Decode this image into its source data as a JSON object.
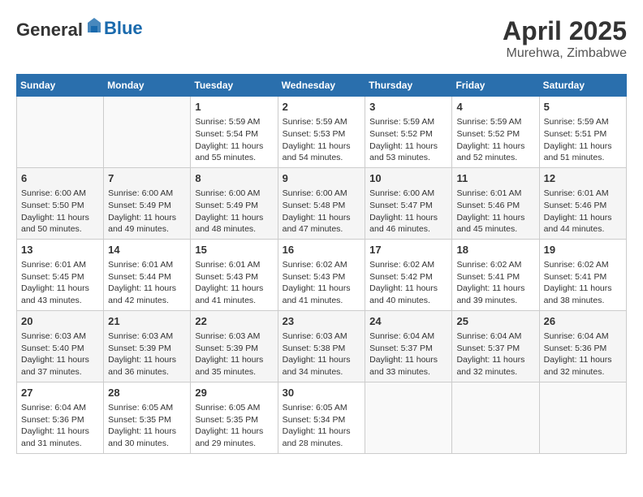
{
  "header": {
    "logo_general": "General",
    "logo_blue": "Blue",
    "month": "April 2025",
    "location": "Murehwa, Zimbabwe"
  },
  "weekdays": [
    "Sunday",
    "Monday",
    "Tuesday",
    "Wednesday",
    "Thursday",
    "Friday",
    "Saturday"
  ],
  "weeks": [
    [
      {
        "day": "",
        "info": ""
      },
      {
        "day": "",
        "info": ""
      },
      {
        "day": "1",
        "info": "Sunrise: 5:59 AM\nSunset: 5:54 PM\nDaylight: 11 hours and 55 minutes."
      },
      {
        "day": "2",
        "info": "Sunrise: 5:59 AM\nSunset: 5:53 PM\nDaylight: 11 hours and 54 minutes."
      },
      {
        "day": "3",
        "info": "Sunrise: 5:59 AM\nSunset: 5:52 PM\nDaylight: 11 hours and 53 minutes."
      },
      {
        "day": "4",
        "info": "Sunrise: 5:59 AM\nSunset: 5:52 PM\nDaylight: 11 hours and 52 minutes."
      },
      {
        "day": "5",
        "info": "Sunrise: 5:59 AM\nSunset: 5:51 PM\nDaylight: 11 hours and 51 minutes."
      }
    ],
    [
      {
        "day": "6",
        "info": "Sunrise: 6:00 AM\nSunset: 5:50 PM\nDaylight: 11 hours and 50 minutes."
      },
      {
        "day": "7",
        "info": "Sunrise: 6:00 AM\nSunset: 5:49 PM\nDaylight: 11 hours and 49 minutes."
      },
      {
        "day": "8",
        "info": "Sunrise: 6:00 AM\nSunset: 5:49 PM\nDaylight: 11 hours and 48 minutes."
      },
      {
        "day": "9",
        "info": "Sunrise: 6:00 AM\nSunset: 5:48 PM\nDaylight: 11 hours and 47 minutes."
      },
      {
        "day": "10",
        "info": "Sunrise: 6:00 AM\nSunset: 5:47 PM\nDaylight: 11 hours and 46 minutes."
      },
      {
        "day": "11",
        "info": "Sunrise: 6:01 AM\nSunset: 5:46 PM\nDaylight: 11 hours and 45 minutes."
      },
      {
        "day": "12",
        "info": "Sunrise: 6:01 AM\nSunset: 5:46 PM\nDaylight: 11 hours and 44 minutes."
      }
    ],
    [
      {
        "day": "13",
        "info": "Sunrise: 6:01 AM\nSunset: 5:45 PM\nDaylight: 11 hours and 43 minutes."
      },
      {
        "day": "14",
        "info": "Sunrise: 6:01 AM\nSunset: 5:44 PM\nDaylight: 11 hours and 42 minutes."
      },
      {
        "day": "15",
        "info": "Sunrise: 6:01 AM\nSunset: 5:43 PM\nDaylight: 11 hours and 41 minutes."
      },
      {
        "day": "16",
        "info": "Sunrise: 6:02 AM\nSunset: 5:43 PM\nDaylight: 11 hours and 41 minutes."
      },
      {
        "day": "17",
        "info": "Sunrise: 6:02 AM\nSunset: 5:42 PM\nDaylight: 11 hours and 40 minutes."
      },
      {
        "day": "18",
        "info": "Sunrise: 6:02 AM\nSunset: 5:41 PM\nDaylight: 11 hours and 39 minutes."
      },
      {
        "day": "19",
        "info": "Sunrise: 6:02 AM\nSunset: 5:41 PM\nDaylight: 11 hours and 38 minutes."
      }
    ],
    [
      {
        "day": "20",
        "info": "Sunrise: 6:03 AM\nSunset: 5:40 PM\nDaylight: 11 hours and 37 minutes."
      },
      {
        "day": "21",
        "info": "Sunrise: 6:03 AM\nSunset: 5:39 PM\nDaylight: 11 hours and 36 minutes."
      },
      {
        "day": "22",
        "info": "Sunrise: 6:03 AM\nSunset: 5:39 PM\nDaylight: 11 hours and 35 minutes."
      },
      {
        "day": "23",
        "info": "Sunrise: 6:03 AM\nSunset: 5:38 PM\nDaylight: 11 hours and 34 minutes."
      },
      {
        "day": "24",
        "info": "Sunrise: 6:04 AM\nSunset: 5:37 PM\nDaylight: 11 hours and 33 minutes."
      },
      {
        "day": "25",
        "info": "Sunrise: 6:04 AM\nSunset: 5:37 PM\nDaylight: 11 hours and 32 minutes."
      },
      {
        "day": "26",
        "info": "Sunrise: 6:04 AM\nSunset: 5:36 PM\nDaylight: 11 hours and 32 minutes."
      }
    ],
    [
      {
        "day": "27",
        "info": "Sunrise: 6:04 AM\nSunset: 5:36 PM\nDaylight: 11 hours and 31 minutes."
      },
      {
        "day": "28",
        "info": "Sunrise: 6:05 AM\nSunset: 5:35 PM\nDaylight: 11 hours and 30 minutes."
      },
      {
        "day": "29",
        "info": "Sunrise: 6:05 AM\nSunset: 5:35 PM\nDaylight: 11 hours and 29 minutes."
      },
      {
        "day": "30",
        "info": "Sunrise: 6:05 AM\nSunset: 5:34 PM\nDaylight: 11 hours and 28 minutes."
      },
      {
        "day": "",
        "info": ""
      },
      {
        "day": "",
        "info": ""
      },
      {
        "day": "",
        "info": ""
      }
    ]
  ]
}
